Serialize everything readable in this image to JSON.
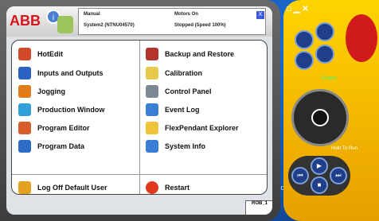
{
  "header": {
    "logo": "ABB",
    "mode": "Manual",
    "system": "System2 (NTNU04570)",
    "motors": "Motors On",
    "state": "Stopped (Speed 100%)",
    "close": "X"
  },
  "menu": {
    "left": [
      {
        "label": "HotEdit",
        "color": "#d04a2b"
      },
      {
        "label": "Inputs and Outputs",
        "color": "#2b62c4"
      },
      {
        "label": "Jogging",
        "color": "#e07b18"
      },
      {
        "label": "Production Window",
        "color": "#2fa0d8"
      },
      {
        "label": "Program Editor",
        "color": "#d85d2a"
      },
      {
        "label": "Program Data",
        "color": "#2f6cc8"
      }
    ],
    "right": [
      {
        "label": "Backup and Restore",
        "color": "#b4332b"
      },
      {
        "label": "Calibration",
        "color": "#e6c84a"
      },
      {
        "label": "Control Panel",
        "color": "#7d8894"
      },
      {
        "label": "Event Log",
        "color": "#3a7ed6"
      },
      {
        "label": "FlexPendant Explorer",
        "color": "#f0c43a"
      },
      {
        "label": "System Info",
        "color": "#3a7ed6"
      }
    ],
    "logoff": "Log Off Default User",
    "restart": "Restart"
  },
  "taskbar": {
    "rob": "ROB_1"
  },
  "panel": {
    "enable": "Enable",
    "hold_to_run": "Hold To Run",
    "desktop_text": "rved"
  }
}
